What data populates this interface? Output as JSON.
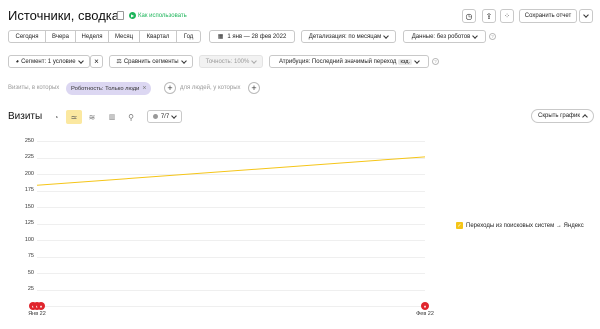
{
  "header": {
    "title": "Источники, сводка",
    "how_to_use": "Как использовать",
    "save_report": "Сохранить отчет"
  },
  "period_tabs": [
    "Сегодня",
    "Вчера",
    "Неделя",
    "Месяц",
    "Квартал",
    "Год"
  ],
  "date_range": "1 янв — 28 фев 2022",
  "detail": "Детализация: по месяцам",
  "data_filter": "Данные: без роботов",
  "segment": "Сегмент: 1 условие",
  "compare": "Сравнить сегменты",
  "accuracy": "Точность: 100%",
  "attribution": "Атрибуция: Последний значимый переход",
  "attribution_badge": "кзд.",
  "visits_filter": {
    "prefix": "Визиты, в которых",
    "chip": "Роботность: Только люди",
    "people_prefix": "для людей, у которых"
  },
  "metric": {
    "title": "Визиты",
    "series_count": "7/7",
    "hide_chart": "Скрыть график"
  },
  "chart_data": {
    "type": "line",
    "x": [
      "Янв 22",
      "Фев 22"
    ],
    "series": [
      {
        "name": "Переходы из поисковых систем → Яндекс",
        "values": [
          183,
          226
        ],
        "color": "#f5c518"
      }
    ],
    "ylim": [
      0,
      250
    ],
    "yticks": [
      0,
      25,
      50,
      75,
      100,
      125,
      150,
      175,
      200,
      225,
      250
    ],
    "grid": true,
    "legend_position": "right"
  },
  "colors": {
    "accent_green": "#1db55a",
    "line": "#f5c518",
    "chip_bg": "#dcd7f2",
    "marker": "#e0252d"
  }
}
